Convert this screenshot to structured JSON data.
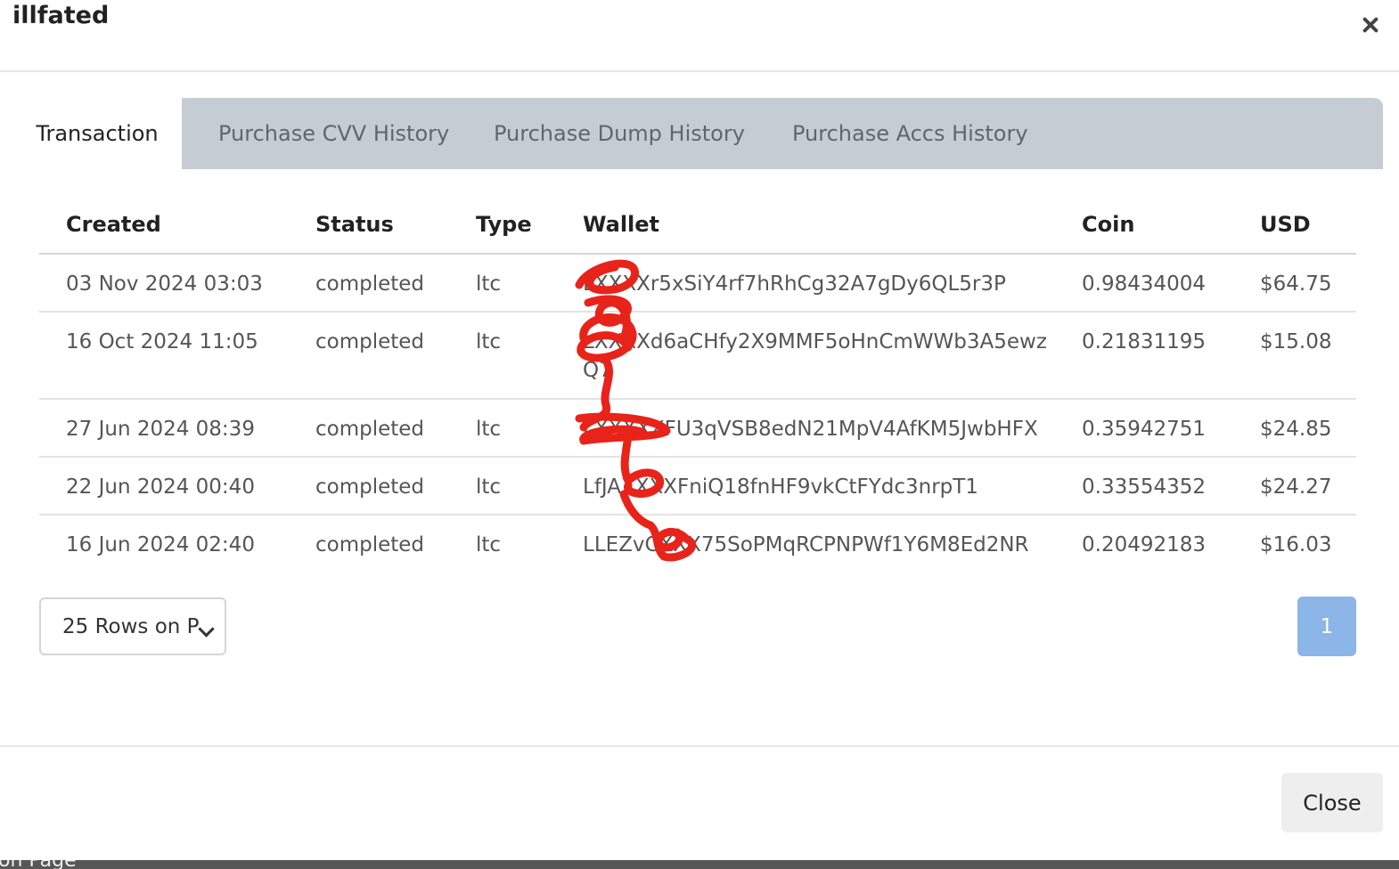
{
  "modal": {
    "title": "illfated",
    "close_label": "Close"
  },
  "tabs": [
    {
      "label": "Transaction",
      "active": true
    },
    {
      "label": "Purchase CVV History",
      "active": false
    },
    {
      "label": "Purchase Dump History",
      "active": false
    },
    {
      "label": "Purchase Accs History",
      "active": false
    }
  ],
  "table": {
    "headers": [
      "Created",
      "Status",
      "Type",
      "Wallet",
      "Coin",
      "USD"
    ],
    "rows": [
      {
        "created": "03 Nov 2024 03:03",
        "status": "completed",
        "type": "ltc",
        "wallet": "LXXXXr5xSiY4rf7hRhCg32A7gDy6QL5r3P",
        "coin": "0.98434004",
        "usd": "$64.75"
      },
      {
        "created": "16 Oct 2024 11:05",
        "status": "completed",
        "type": "ltc",
        "wallet": "LXXXXd6aCHfy2X9MMF5oHnCmWWb3A5ewzQ7",
        "coin": "0.21831195",
        "usd": "$15.08"
      },
      {
        "created": "27 Jun 2024 08:39",
        "status": "completed",
        "type": "ltc",
        "wallet": "LXXXXXFU3qVSB8edN21MpV4AfKM5JwbHFX",
        "coin": "0.35942751",
        "usd": "$24.85"
      },
      {
        "created": "22 Jun 2024 00:40",
        "status": "completed",
        "type": "ltc",
        "wallet": "LfJAXXXXFniQ18fnHF9vkCtFYdc3nrpT1",
        "coin": "0.33554352",
        "usd": "$24.27"
      },
      {
        "created": "16 Jun 2024 02:40",
        "status": "completed",
        "type": "ltc",
        "wallet": "LLEZvCXXX75SoPMqRCPNPWf1Y6M8Ed2NR",
        "coin": "0.20492183",
        "usd": "$16.03"
      }
    ]
  },
  "pagination": {
    "rows_per_page": "25 Rows on P",
    "current_page": "1"
  },
  "background": {
    "ghost_text": "on Page"
  },
  "colors": {
    "tab_bar": "#c6ccd3",
    "page_button": "#8cb5e8",
    "redaction": "#e8231a"
  },
  "icons": {
    "modal_close": "close-icon",
    "select_arrow": "chevron-down-icon"
  }
}
